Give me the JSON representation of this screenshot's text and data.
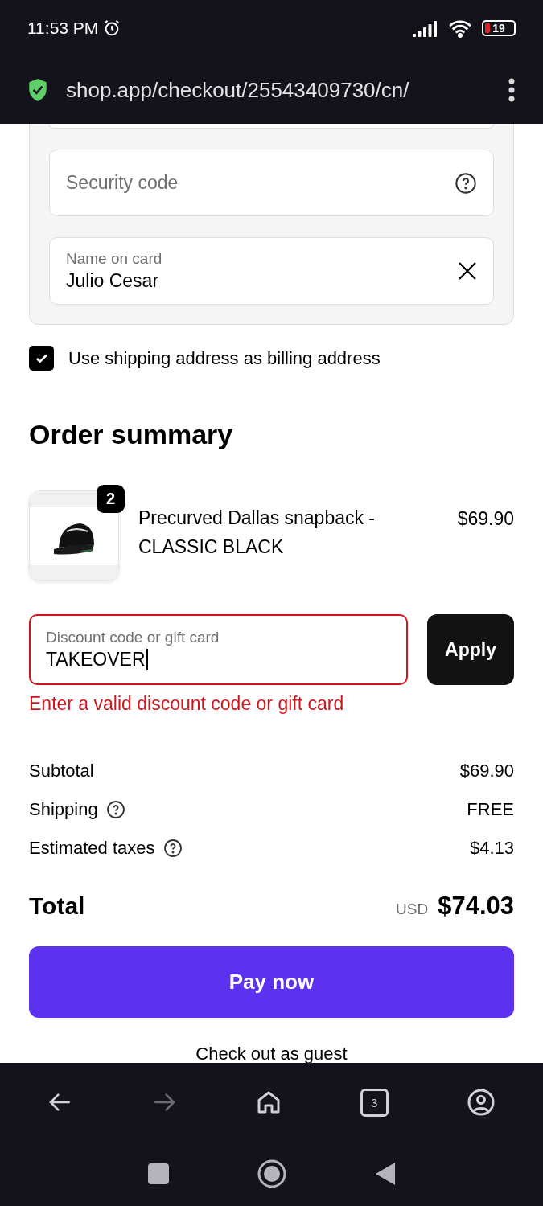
{
  "status_bar": {
    "time": "11:53 PM",
    "alarm": true,
    "battery": "19"
  },
  "browser": {
    "url": "shop.app/checkout/25543409730/cn/",
    "secure": true
  },
  "payment": {
    "security_code": {
      "placeholder": "Security code"
    },
    "name_on_card": {
      "label": "Name on card",
      "value": "Julio Cesar"
    }
  },
  "billing_same_as_shipping": {
    "label": "Use shipping address as billing address",
    "checked": true
  },
  "order_summary": {
    "title": "Order summary",
    "items": [
      {
        "quantity": "2",
        "name": "Precurved Dallas snapback - CLASSIC BLACK",
        "price": "$69.90"
      }
    ],
    "discount": {
      "label": "Discount code or gift card",
      "value": "TAKEOVER",
      "invalid": true,
      "error": "Enter a valid discount code or gift card",
      "button": "Apply"
    },
    "lines": [
      {
        "label": "Subtotal",
        "value": "$69.90",
        "help": false
      },
      {
        "label": "Shipping",
        "value": "FREE",
        "help": true
      },
      {
        "label": "Estimated taxes",
        "value": "$4.13",
        "help": true
      }
    ],
    "total": {
      "label": "Total",
      "currency": "USD",
      "value": "$74.03"
    },
    "pay_button": "Pay now",
    "guest_link": "Check out as guest"
  },
  "browser_toolbar": {
    "back_disabled": false,
    "forward_disabled": true,
    "tabs_count": "3"
  }
}
